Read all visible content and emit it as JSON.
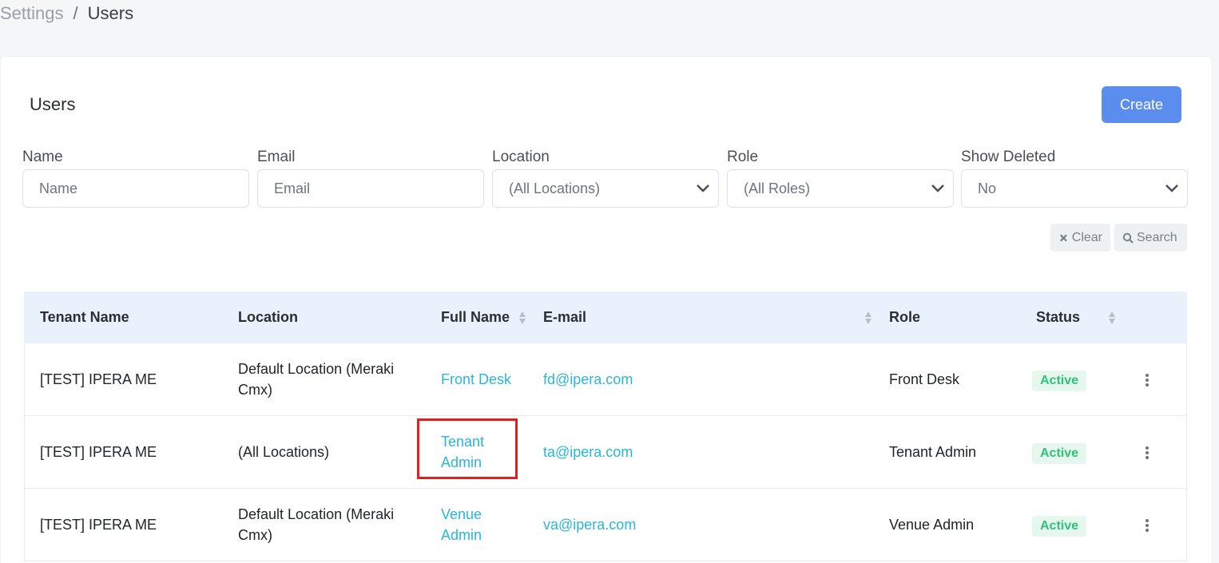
{
  "breadcrumb": {
    "parent": "Settings",
    "separator": "/",
    "current": "Users"
  },
  "page": {
    "title": "Users",
    "create_label": "Create"
  },
  "filters": {
    "name": {
      "label": "Name",
      "placeholder": "Name"
    },
    "email": {
      "label": "Email",
      "placeholder": "Email"
    },
    "location": {
      "label": "Location",
      "value": "(All Locations)"
    },
    "role": {
      "label": "Role",
      "value": "(All Roles)"
    },
    "show_deleted": {
      "label": "Show Deleted",
      "value": "No"
    }
  },
  "actions": {
    "clear_label": "Clear",
    "search_label": "Search"
  },
  "table": {
    "columns": [
      "Tenant Name",
      "Location",
      "Full Name",
      "E-mail",
      "Role",
      "Status"
    ],
    "rows": [
      {
        "tenant": "[TEST] IPERA ME",
        "location": "Default Location (Meraki Cmx)",
        "full_name": "Front Desk",
        "email": "fd@ipera.com",
        "role": "Front Desk",
        "status": "Active"
      },
      {
        "tenant": "[TEST] IPERA ME",
        "location": "(All Locations)",
        "full_name": "Tenant Admin",
        "email": "ta@ipera.com",
        "role": "Tenant Admin",
        "status": "Active"
      },
      {
        "tenant": "[TEST] IPERA ME",
        "location": "Default Location (Meraki Cmx)",
        "full_name": "Venue Admin",
        "email": "va@ipera.com",
        "role": "Venue Admin",
        "status": "Active"
      }
    ]
  },
  "colors": {
    "accent": "#5b8def",
    "link": "#29b6d8",
    "status_active": "#2fc27a",
    "highlight": "#e02020"
  }
}
